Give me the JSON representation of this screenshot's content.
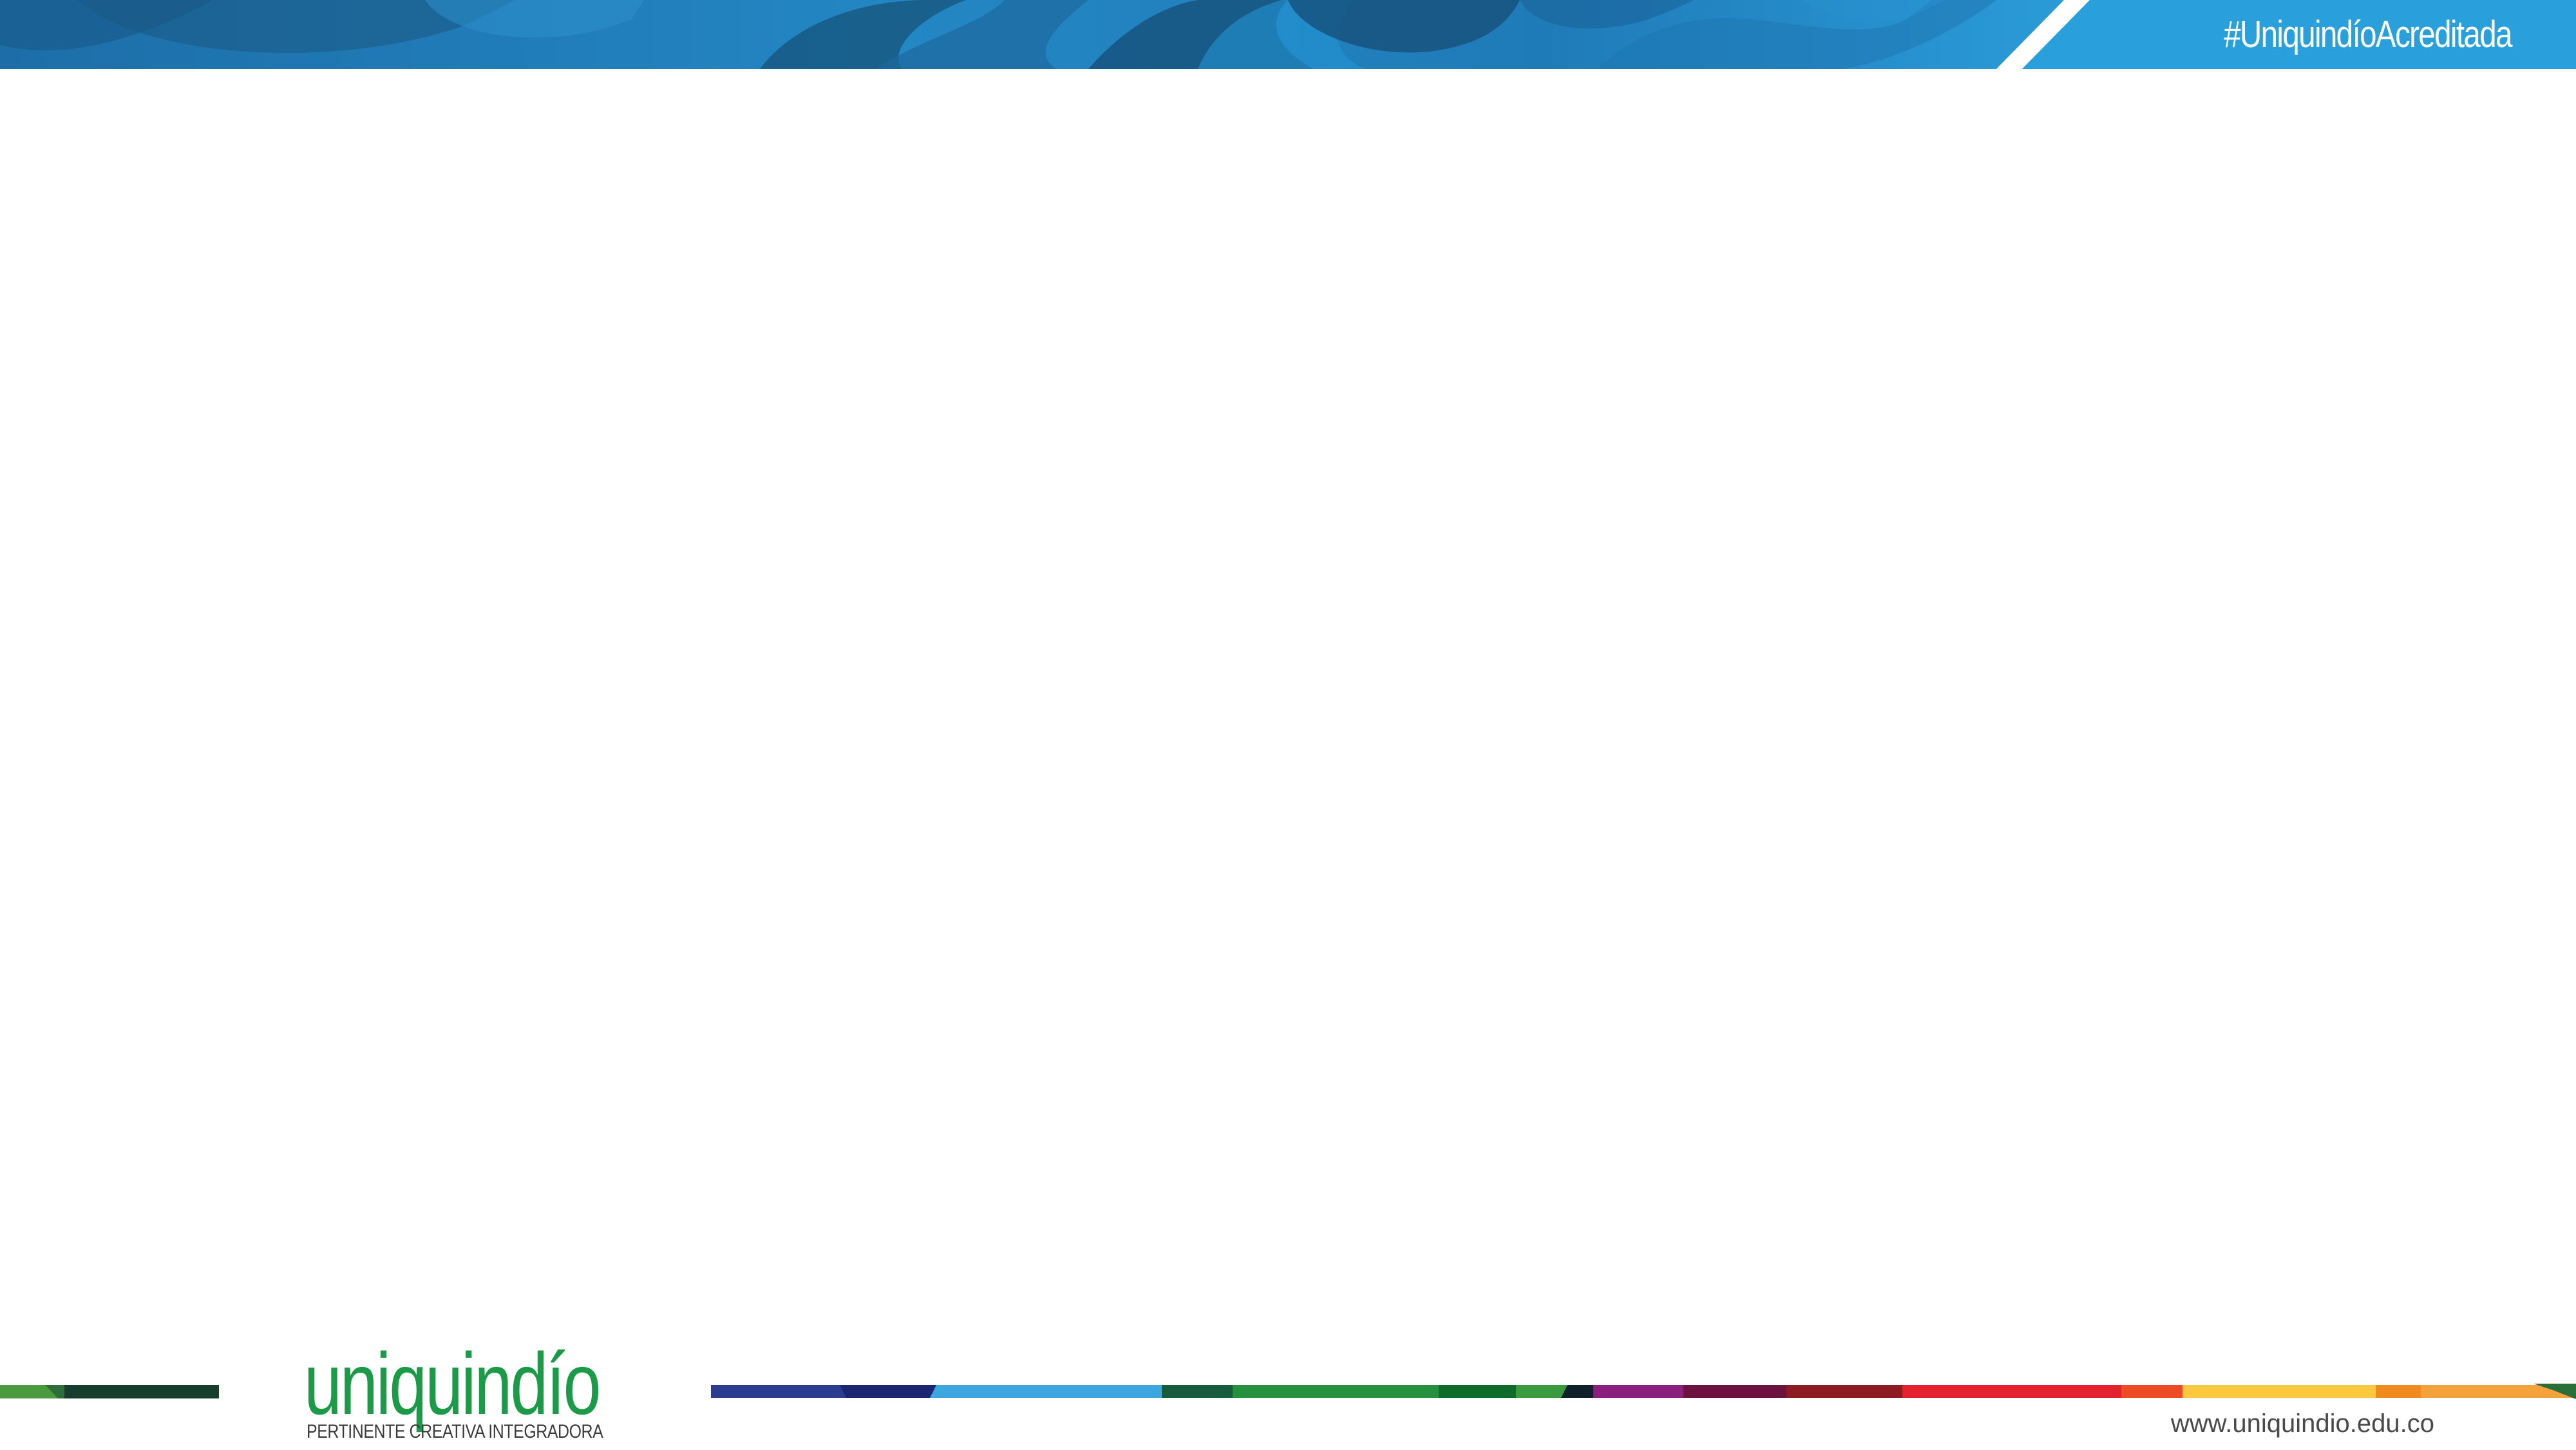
{
  "header": {
    "hashtag": "#UniquindíoAcreditada",
    "colors": {
      "banner_dark": "#1b5f8c",
      "banner_mid": "#2380bd",
      "banner_light": "#29a0dc"
    }
  },
  "footer": {
    "logo": {
      "wordmark": "uniquindío",
      "tagline": "PERTINENTE CREATIVA INTEGRADORA",
      "color": "#1b9a48"
    },
    "website": "www.uniquindio.edu.co"
  }
}
